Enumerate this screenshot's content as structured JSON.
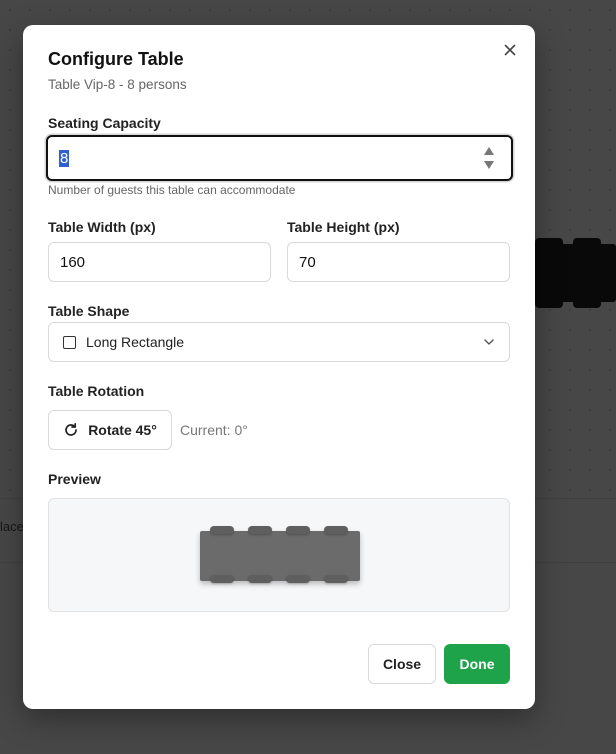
{
  "background": {
    "footer_text": "lace"
  },
  "dialog": {
    "title": "Configure Table",
    "subtitle": "Table Vip-8 - 8 persons",
    "close_icon": "close-icon",
    "seating": {
      "label": "Seating Capacity",
      "value": "8",
      "helper": "Number of guests this table can accommodate"
    },
    "width": {
      "label": "Table Width (px)",
      "value": "160"
    },
    "height": {
      "label": "Table Height (px)",
      "value": "70"
    },
    "shape": {
      "label": "Table Shape",
      "selected": "Long Rectangle",
      "icon": "square-icon"
    },
    "rotation": {
      "label": "Table Rotation",
      "button_label": "Rotate 45°",
      "current": "Current: 0°",
      "icon": "rotate-icon"
    },
    "preview": {
      "label": "Preview",
      "chairs_per_side": 4
    },
    "buttons": {
      "close": "Close",
      "done": "Done"
    }
  },
  "colors": {
    "primary": "#1ea34a",
    "selection": "#2f5fd0",
    "overlay": "rgba(0,0,0,0.72)"
  }
}
